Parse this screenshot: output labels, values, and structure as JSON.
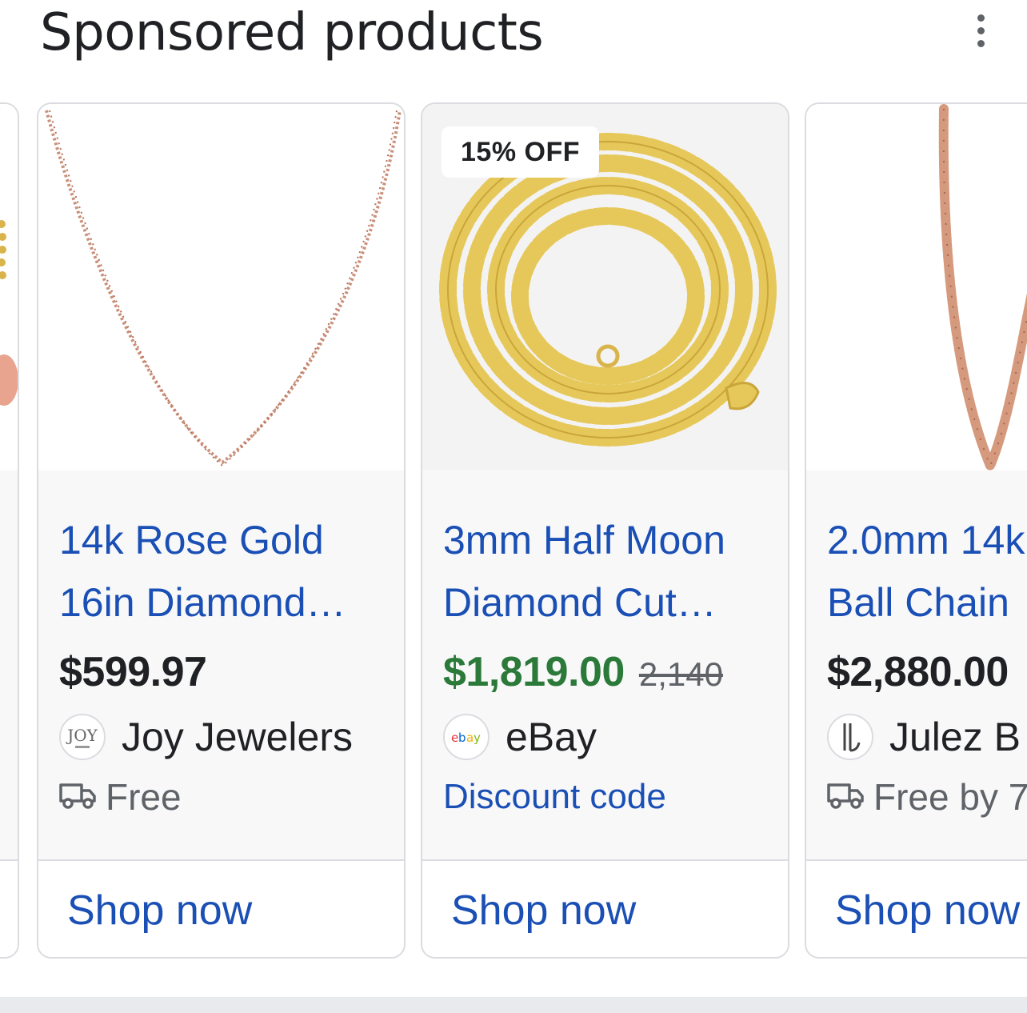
{
  "header": {
    "title": "Sponsored products"
  },
  "cards": [
    {
      "title_line1": "14k Rose Gold",
      "title_line2": "16in Diamond…",
      "price": "$599.97",
      "seller": "Joy Jewelers",
      "seller_logo_icon": "joy-jewelers-logo",
      "shipping": "Free",
      "shop_label": "Shop now"
    },
    {
      "badge": "15% OFF",
      "title_line1": "3mm Half Moon",
      "title_line2": "Diamond Cut…",
      "price": "$1,819.00",
      "old_price": "2,140",
      "seller": "eBay",
      "seller_logo_icon": "ebay-logo",
      "promo": "Discount code",
      "shop_label": "Shop now"
    },
    {
      "title_line1": "2.0mm 14k",
      "title_line2": "Ball Chain",
      "price": "$2,880.00",
      "seller": "Julez B",
      "seller_logo_icon": "julez-logo",
      "shipping": "Free by 7",
      "shop_label": "Shop now"
    }
  ],
  "colors": {
    "link_blue": "#1a4fb5",
    "sale_green": "#2c7a3a",
    "rose_gold": "#c98f78",
    "gold": "#e6c85a"
  }
}
